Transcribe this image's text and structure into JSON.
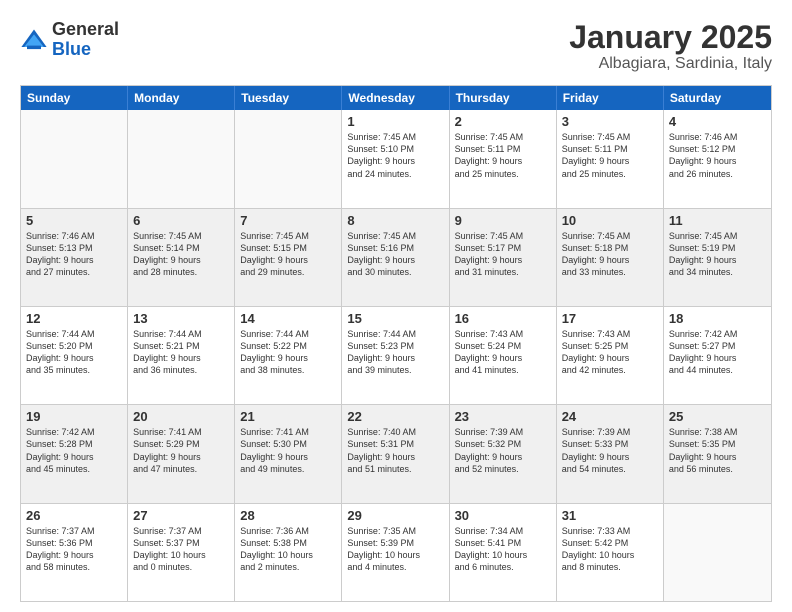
{
  "logo": {
    "general": "General",
    "blue": "Blue"
  },
  "title": "January 2025",
  "location": "Albagiara, Sardinia, Italy",
  "weekdays": [
    "Sunday",
    "Monday",
    "Tuesday",
    "Wednesday",
    "Thursday",
    "Friday",
    "Saturday"
  ],
  "weeks": [
    [
      {
        "day": "",
        "info": "",
        "empty": true
      },
      {
        "day": "",
        "info": "",
        "empty": true
      },
      {
        "day": "",
        "info": "",
        "empty": true
      },
      {
        "day": "1",
        "info": "Sunrise: 7:45 AM\nSunset: 5:10 PM\nDaylight: 9 hours\nand 24 minutes."
      },
      {
        "day": "2",
        "info": "Sunrise: 7:45 AM\nSunset: 5:11 PM\nDaylight: 9 hours\nand 25 minutes."
      },
      {
        "day": "3",
        "info": "Sunrise: 7:45 AM\nSunset: 5:11 PM\nDaylight: 9 hours\nand 25 minutes."
      },
      {
        "day": "4",
        "info": "Sunrise: 7:46 AM\nSunset: 5:12 PM\nDaylight: 9 hours\nand 26 minutes."
      }
    ],
    [
      {
        "day": "5",
        "info": "Sunrise: 7:46 AM\nSunset: 5:13 PM\nDaylight: 9 hours\nand 27 minutes.",
        "shaded": true
      },
      {
        "day": "6",
        "info": "Sunrise: 7:45 AM\nSunset: 5:14 PM\nDaylight: 9 hours\nand 28 minutes.",
        "shaded": true
      },
      {
        "day": "7",
        "info": "Sunrise: 7:45 AM\nSunset: 5:15 PM\nDaylight: 9 hours\nand 29 minutes.",
        "shaded": true
      },
      {
        "day": "8",
        "info": "Sunrise: 7:45 AM\nSunset: 5:16 PM\nDaylight: 9 hours\nand 30 minutes.",
        "shaded": true
      },
      {
        "day": "9",
        "info": "Sunrise: 7:45 AM\nSunset: 5:17 PM\nDaylight: 9 hours\nand 31 minutes.",
        "shaded": true
      },
      {
        "day": "10",
        "info": "Sunrise: 7:45 AM\nSunset: 5:18 PM\nDaylight: 9 hours\nand 33 minutes.",
        "shaded": true
      },
      {
        "day": "11",
        "info": "Sunrise: 7:45 AM\nSunset: 5:19 PM\nDaylight: 9 hours\nand 34 minutes.",
        "shaded": true
      }
    ],
    [
      {
        "day": "12",
        "info": "Sunrise: 7:44 AM\nSunset: 5:20 PM\nDaylight: 9 hours\nand 35 minutes."
      },
      {
        "day": "13",
        "info": "Sunrise: 7:44 AM\nSunset: 5:21 PM\nDaylight: 9 hours\nand 36 minutes."
      },
      {
        "day": "14",
        "info": "Sunrise: 7:44 AM\nSunset: 5:22 PM\nDaylight: 9 hours\nand 38 minutes."
      },
      {
        "day": "15",
        "info": "Sunrise: 7:44 AM\nSunset: 5:23 PM\nDaylight: 9 hours\nand 39 minutes."
      },
      {
        "day": "16",
        "info": "Sunrise: 7:43 AM\nSunset: 5:24 PM\nDaylight: 9 hours\nand 41 minutes."
      },
      {
        "day": "17",
        "info": "Sunrise: 7:43 AM\nSunset: 5:25 PM\nDaylight: 9 hours\nand 42 minutes."
      },
      {
        "day": "18",
        "info": "Sunrise: 7:42 AM\nSunset: 5:27 PM\nDaylight: 9 hours\nand 44 minutes."
      }
    ],
    [
      {
        "day": "19",
        "info": "Sunrise: 7:42 AM\nSunset: 5:28 PM\nDaylight: 9 hours\nand 45 minutes.",
        "shaded": true
      },
      {
        "day": "20",
        "info": "Sunrise: 7:41 AM\nSunset: 5:29 PM\nDaylight: 9 hours\nand 47 minutes.",
        "shaded": true
      },
      {
        "day": "21",
        "info": "Sunrise: 7:41 AM\nSunset: 5:30 PM\nDaylight: 9 hours\nand 49 minutes.",
        "shaded": true
      },
      {
        "day": "22",
        "info": "Sunrise: 7:40 AM\nSunset: 5:31 PM\nDaylight: 9 hours\nand 51 minutes.",
        "shaded": true
      },
      {
        "day": "23",
        "info": "Sunrise: 7:39 AM\nSunset: 5:32 PM\nDaylight: 9 hours\nand 52 minutes.",
        "shaded": true
      },
      {
        "day": "24",
        "info": "Sunrise: 7:39 AM\nSunset: 5:33 PM\nDaylight: 9 hours\nand 54 minutes.",
        "shaded": true
      },
      {
        "day": "25",
        "info": "Sunrise: 7:38 AM\nSunset: 5:35 PM\nDaylight: 9 hours\nand 56 minutes.",
        "shaded": true
      }
    ],
    [
      {
        "day": "26",
        "info": "Sunrise: 7:37 AM\nSunset: 5:36 PM\nDaylight: 9 hours\nand 58 minutes."
      },
      {
        "day": "27",
        "info": "Sunrise: 7:37 AM\nSunset: 5:37 PM\nDaylight: 10 hours\nand 0 minutes."
      },
      {
        "day": "28",
        "info": "Sunrise: 7:36 AM\nSunset: 5:38 PM\nDaylight: 10 hours\nand 2 minutes."
      },
      {
        "day": "29",
        "info": "Sunrise: 7:35 AM\nSunset: 5:39 PM\nDaylight: 10 hours\nand 4 minutes."
      },
      {
        "day": "30",
        "info": "Sunrise: 7:34 AM\nSunset: 5:41 PM\nDaylight: 10 hours\nand 6 minutes."
      },
      {
        "day": "31",
        "info": "Sunrise: 7:33 AM\nSunset: 5:42 PM\nDaylight: 10 hours\nand 8 minutes."
      },
      {
        "day": "",
        "info": "",
        "empty": true
      }
    ]
  ]
}
